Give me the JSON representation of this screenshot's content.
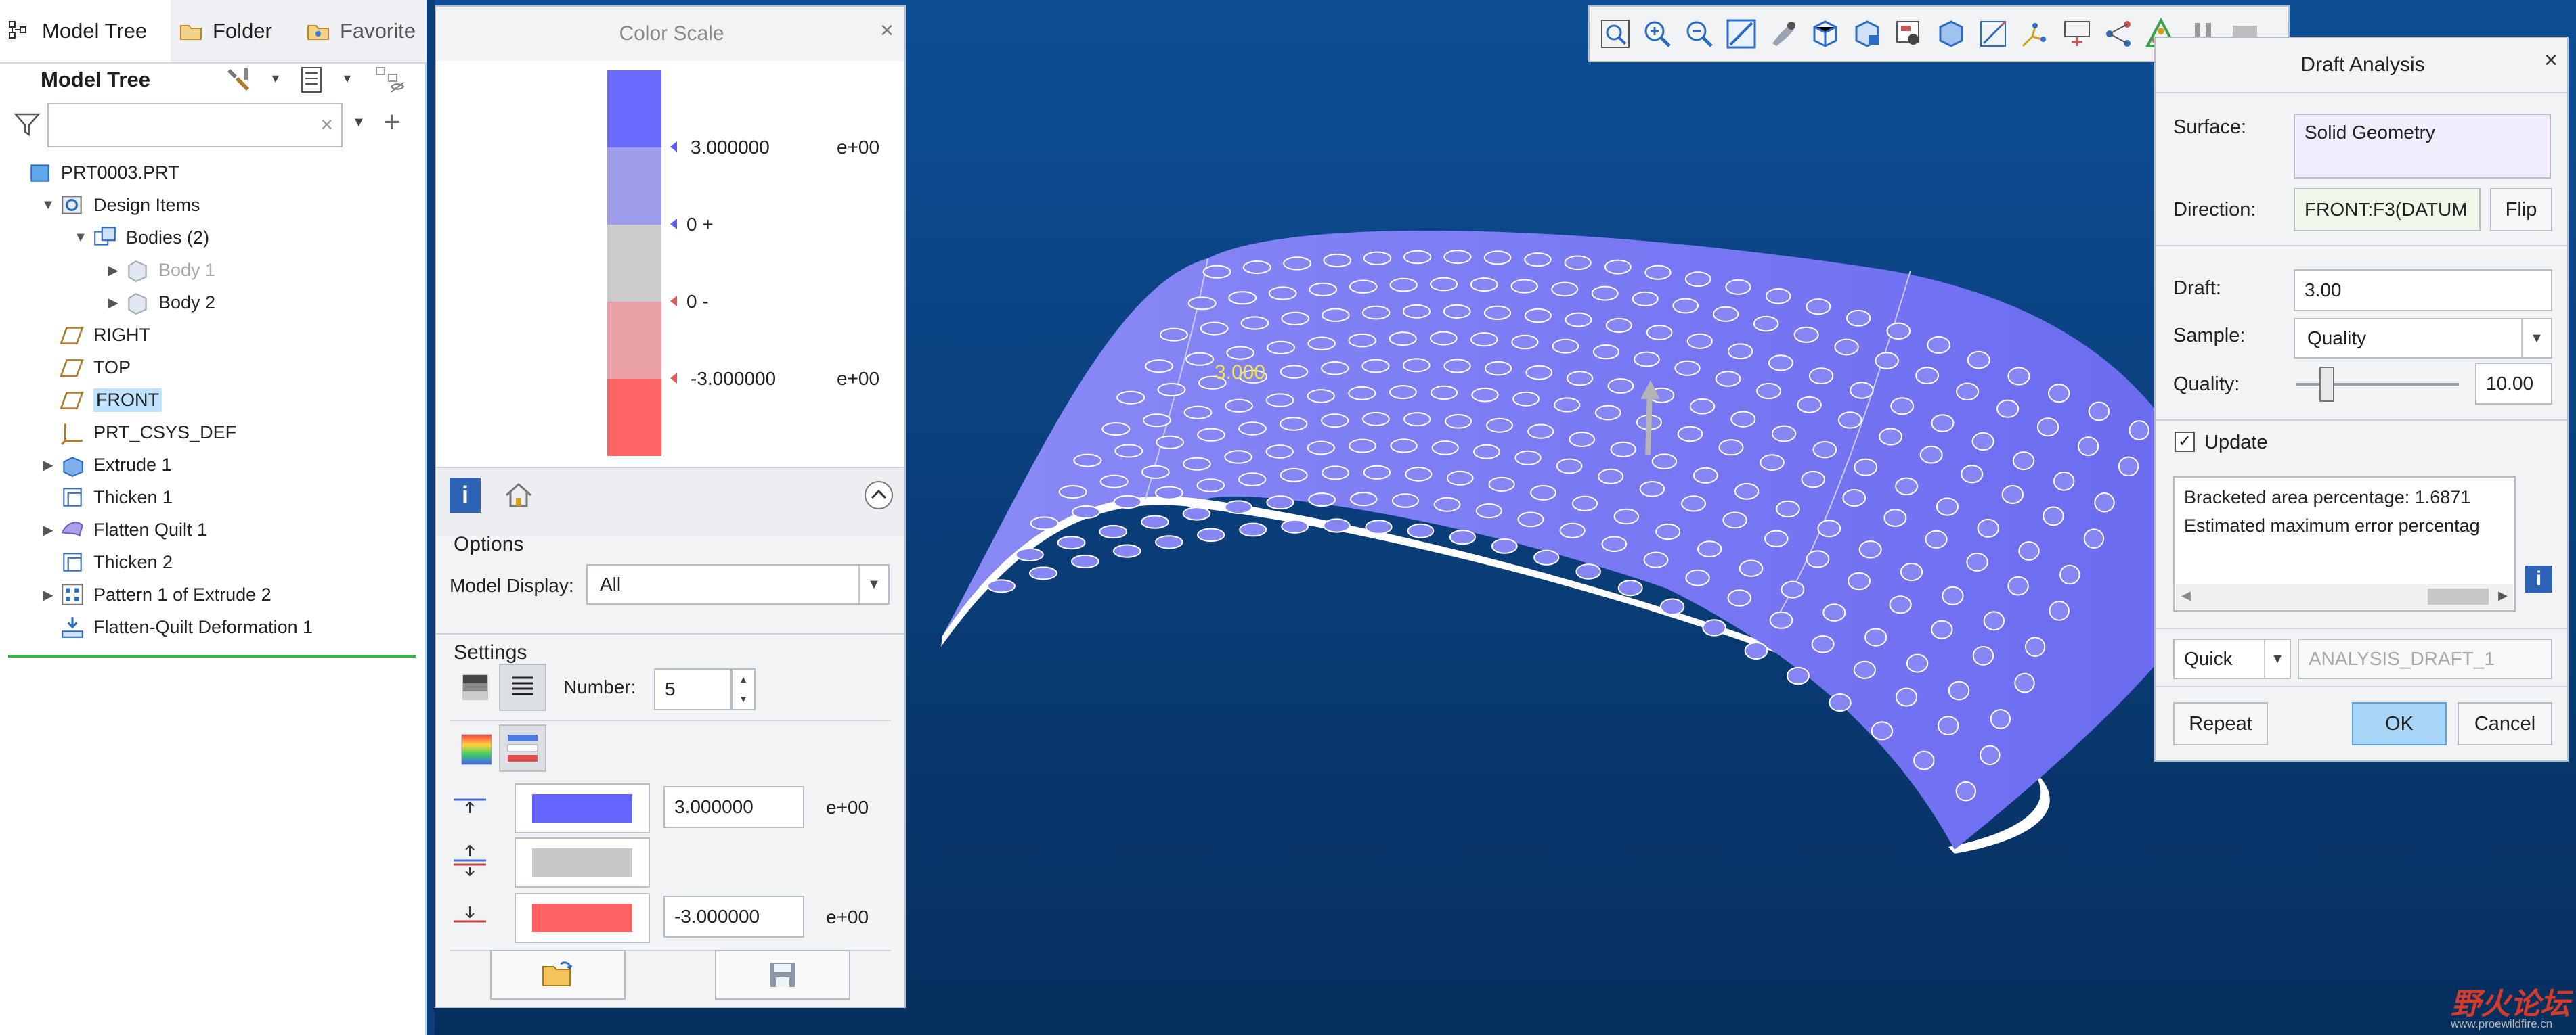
{
  "tree_tabs": [
    "Model Tree",
    "Folder",
    "Favorite"
  ],
  "tree_title": "Model Tree",
  "tree_items": [
    {
      "label": "PRT0003.PRT",
      "icon": "part-icon",
      "indent": 0,
      "expander": "",
      "dim": false,
      "highlight": false
    },
    {
      "label": "Design Items",
      "icon": "design-items-icon",
      "indent": 1,
      "expander": "▼",
      "dim": false,
      "highlight": false
    },
    {
      "label": "Bodies (2)",
      "icon": "bodies-icon",
      "indent": 2,
      "expander": "▼",
      "dim": false,
      "highlight": false
    },
    {
      "label": "Body 1",
      "icon": "body-icon",
      "indent": 3,
      "expander": "▶",
      "dim": true,
      "highlight": false
    },
    {
      "label": "Body 2",
      "icon": "body-icon",
      "indent": 3,
      "expander": "▶",
      "dim": false,
      "highlight": false
    },
    {
      "label": "RIGHT",
      "icon": "datum-plane-icon",
      "indent": 1,
      "expander": "",
      "dim": false,
      "highlight": false
    },
    {
      "label": "TOP",
      "icon": "datum-plane-icon",
      "indent": 1,
      "expander": "",
      "dim": false,
      "highlight": false
    },
    {
      "label": "FRONT",
      "icon": "datum-plane-icon",
      "indent": 1,
      "expander": "",
      "dim": false,
      "highlight": true
    },
    {
      "label": "PRT_CSYS_DEF",
      "icon": "csys-icon",
      "indent": 1,
      "expander": "",
      "dim": false,
      "highlight": false
    },
    {
      "label": "Extrude 1",
      "icon": "extrude-icon",
      "indent": 1,
      "expander": "▶",
      "dim": false,
      "highlight": false
    },
    {
      "label": "Thicken 1",
      "icon": "thicken-icon",
      "indent": 1,
      "expander": "",
      "dim": false,
      "highlight": false
    },
    {
      "label": "Flatten Quilt 1",
      "icon": "flatten-quilt-icon",
      "indent": 1,
      "expander": "▶",
      "dim": false,
      "highlight": false
    },
    {
      "label": "Thicken 2",
      "icon": "thicken-icon",
      "indent": 1,
      "expander": "",
      "dim": false,
      "highlight": false
    },
    {
      "label": "Pattern 1 of Extrude 2",
      "icon": "pattern-icon",
      "indent": 1,
      "expander": "▶",
      "dim": false,
      "highlight": false
    },
    {
      "label": "Flatten-Quilt Deformation 1",
      "icon": "deformation-icon",
      "indent": 1,
      "expander": "",
      "dim": false,
      "highlight": false
    }
  ],
  "color_scale": {
    "title": "Color Scale",
    "bands": [
      "#6b6bff",
      "#9d9dea",
      "#cccccc",
      "#e8a0a6",
      "#ff6464"
    ],
    "values": [
      {
        "text": "3.000000",
        "suffix": "e+00",
        "color": "#5b5bff"
      },
      {
        "text": "0 +",
        "suffix": "",
        "color": "#5b5bff"
      },
      {
        "text": "0 -",
        "suffix": "",
        "color": "#e05a5a"
      },
      {
        "text": "-3.000000",
        "suffix": "e+00",
        "color": "#e05a5a"
      }
    ],
    "options_label": "Options",
    "model_display_label": "Model Display:",
    "model_display_value": "All",
    "settings_label": "Settings",
    "number_label": "Number:",
    "number_value": "5",
    "rows": [
      {
        "color": "#6464ff",
        "value": "3.000000",
        "suffix": "e+00"
      },
      {
        "color": "#c8c8c8",
        "value": "",
        "suffix": ""
      },
      {
        "color": "#ff6262",
        "value": "-3.000000",
        "suffix": "e+00"
      }
    ]
  },
  "viewport": {
    "annotation": "3.000",
    "surface_color": "#7474f2"
  },
  "draft_analysis": {
    "title": "Draft Analysis",
    "surface_label": "Surface:",
    "surface_value": "Solid Geometry",
    "direction_label": "Direction:",
    "direction_value": "FRONT:F3(DATUM",
    "flip_label": "Flip",
    "draft_label": "Draft:",
    "draft_value": "3.00",
    "sample_label": "Sample:",
    "sample_value": "Quality",
    "quality_label": "Quality:",
    "quality_value": "10.00",
    "quality_slider": 0.14,
    "update_label": "Update",
    "info_lines": [
      "Bracketed area percentage: 1.6871",
      "Estimated maximum error percentag"
    ],
    "mode_value": "Quick",
    "name_placeholder": "ANALYSIS_DRAFT_1",
    "repeat_label": "Repeat",
    "ok_label": "OK",
    "cancel_label": "Cancel"
  },
  "watermark": {
    "text": "野火论坛",
    "url": "www.proewildfire.cn"
  }
}
